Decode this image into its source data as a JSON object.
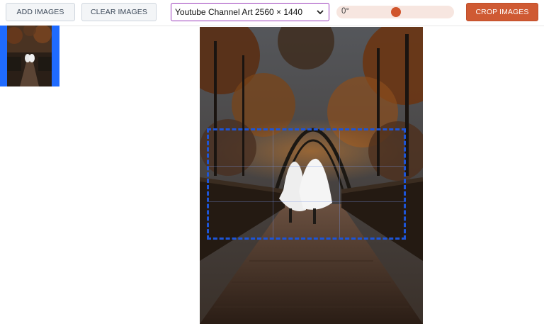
{
  "toolbar": {
    "add_label": "ADD IMAGES",
    "clear_label": "CLEAR IMAGES",
    "crop_label": "CROP IMAGES",
    "preset_value": "Youtube Channel Art 2560 × 1440",
    "rotation_value": "0°",
    "rotation_level": 0.5
  },
  "colors": {
    "accent": "#cf5a33",
    "selection": "#1f6bff",
    "crop_outline": "#1d55d8",
    "select_border": "#9b3dbb"
  },
  "icons": {
    "dropdown": "chevron-down-icon"
  }
}
